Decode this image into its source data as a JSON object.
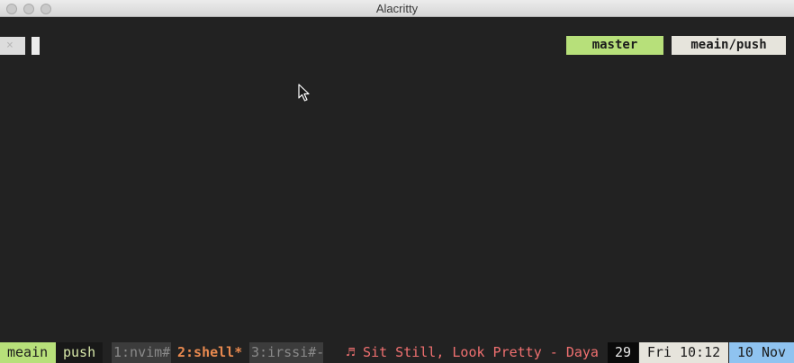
{
  "window": {
    "title": "Alacritty"
  },
  "terminal": {
    "prompt_symbol": "×",
    "git": {
      "local_branch": "master",
      "remote_branch": "meain/push"
    }
  },
  "statusbar": {
    "session_name": "meain",
    "mode": "push",
    "windows": [
      {
        "label": "1:nvim#"
      },
      {
        "label": "2:shell*"
      },
      {
        "label": "3:irssi#-"
      }
    ],
    "now_playing": "♬ Sit Still, Look Pretty - Daya",
    "battery": "29",
    "clock": "Fri 10:12",
    "date": "10 Nov"
  },
  "colors": {
    "terminal_bg": "#222222",
    "accent_green": "#b7e07a",
    "accent_orange": "#e8894f",
    "accent_red": "#f07070",
    "accent_blue": "#8fc3f0",
    "light_badge": "#e6e4dc"
  },
  "icons": {
    "pointer": "mouse-pointer-icon"
  }
}
